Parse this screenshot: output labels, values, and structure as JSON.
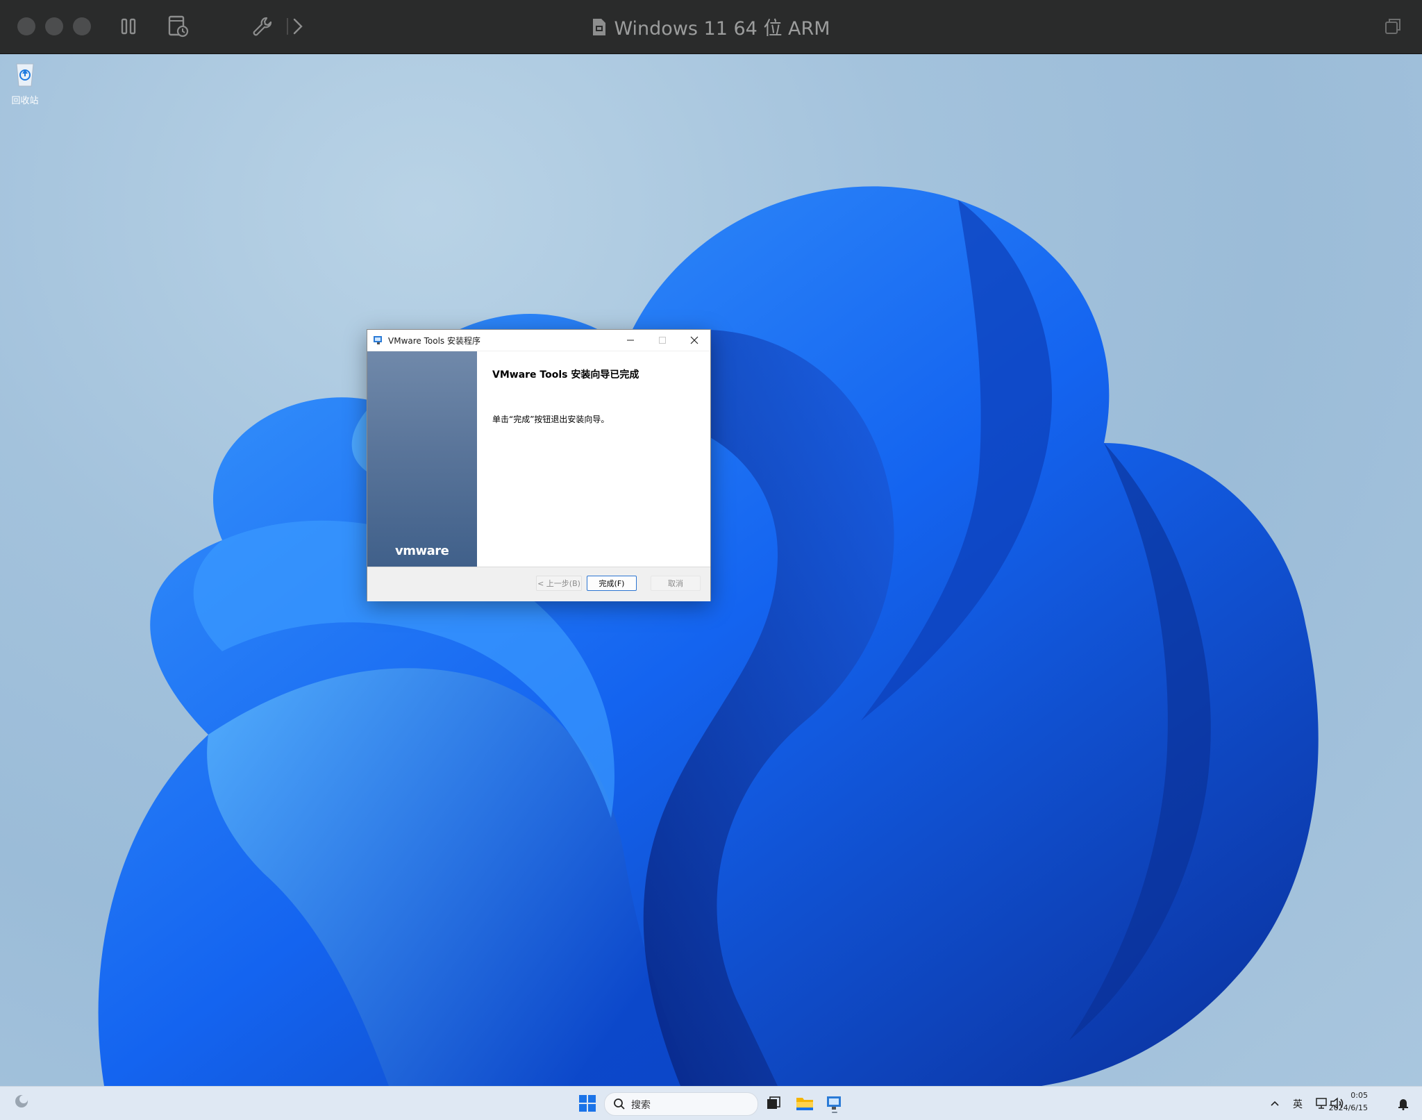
{
  "host_window": {
    "title": "Windows 11 64 位 ARM",
    "traffic_lights": [
      "close",
      "minimize",
      "zoom"
    ],
    "toolbar_icons": [
      "pause-icon",
      "snapshot-icon",
      "settings-wrench-icon",
      "forward-chevron-icon"
    ],
    "right_icon": "restore-window-icon"
  },
  "desktop": {
    "icons": [
      {
        "label": "回收站",
        "icon": "recycle-bin-icon"
      }
    ]
  },
  "dialog": {
    "title": "VMware Tools 安装程序",
    "heading": "VMware Tools 安装向导已完成",
    "message": "单击“完成”按钮退出安装向导。",
    "logo_text": "vmware",
    "buttons": {
      "back": "< 上一步(B)",
      "finish": "完成(F)",
      "cancel": "取消"
    },
    "accent_color": "#2a73d0"
  },
  "taskbar": {
    "search_placeholder": "搜索",
    "pinned": [
      "start-icon",
      "search-icon",
      "task-view-icon",
      "file-explorer-icon",
      "vmware-installer-icon"
    ],
    "tray": {
      "ime": "英",
      "time": "0:05",
      "date": "2024/6/15"
    }
  }
}
